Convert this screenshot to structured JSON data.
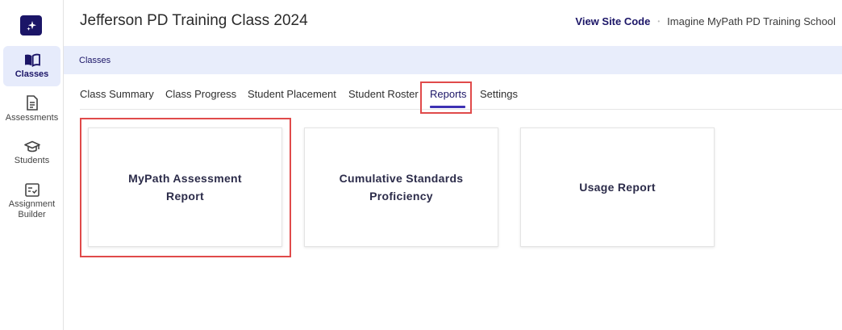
{
  "header": {
    "title": "Jefferson PD Training Class 2024",
    "site_code_link": "View Site Code",
    "separator": "•",
    "school_name": "Imagine MyPath PD Training School"
  },
  "sidebar": {
    "items": [
      {
        "label": "Classes",
        "icon": "book-open-icon",
        "active": true
      },
      {
        "label": "Assessments",
        "icon": "document-icon",
        "active": false
      },
      {
        "label": "Students",
        "icon": "graduation-cap-icon",
        "active": false
      },
      {
        "label": "Assignment Builder",
        "icon": "checklist-icon",
        "active": false
      }
    ]
  },
  "breadcrumb": {
    "label": "Classes"
  },
  "tabs": [
    {
      "label": "Class Summary"
    },
    {
      "label": "Class Progress"
    },
    {
      "label": "Student Placement"
    },
    {
      "label": "Student Roster"
    },
    {
      "label": "Reports",
      "active": true
    },
    {
      "label": "Settings"
    }
  ],
  "cards": [
    {
      "line1": "MyPath Assessment",
      "line2": "Report"
    },
    {
      "line1": "Cumulative Standards",
      "line2": "Proficiency"
    },
    {
      "line1": "Usage Report",
      "line2": ""
    }
  ],
  "colors": {
    "brand": "#1b1567",
    "active_tab_underline": "#3d31b3",
    "breadcrumb_bg": "#e8edfb",
    "highlight": "#e04a4a"
  }
}
